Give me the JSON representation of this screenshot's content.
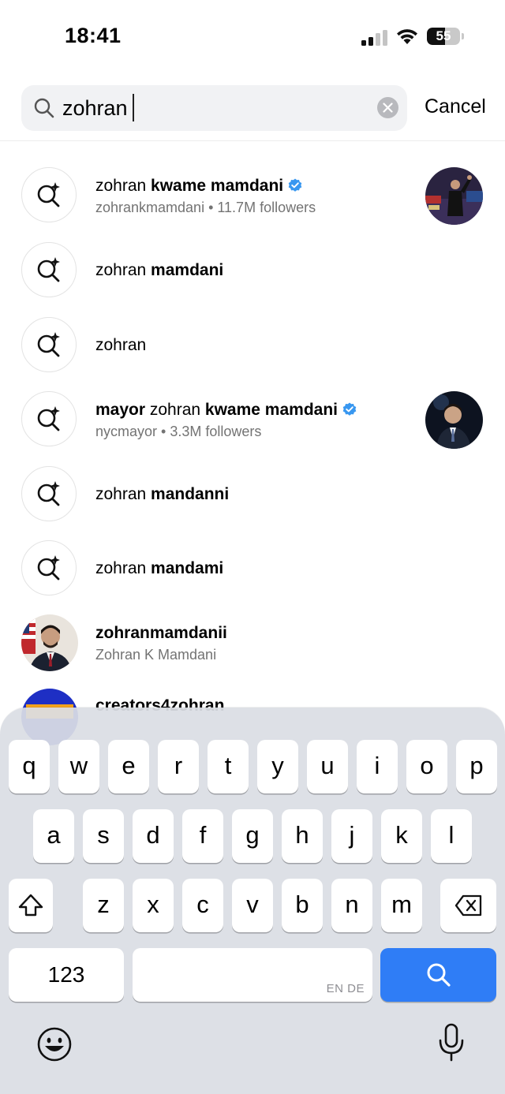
{
  "status_bar": {
    "time": "18:41",
    "battery_level": "55",
    "battery_fraction": 0.55
  },
  "search": {
    "query": "zohran",
    "cancel_label": "Cancel"
  },
  "results": [
    {
      "type": "account",
      "title_plain": "zohran ",
      "title_bold": "kwame mamdani",
      "verified": true,
      "subtitle": "zohrankmamdani • 11.7M followers"
    },
    {
      "type": "query",
      "title_plain": "zohran ",
      "title_bold": "mamdani"
    },
    {
      "type": "query",
      "title_plain": "zohran",
      "title_bold": ""
    },
    {
      "type": "account",
      "title_bold_prefix": "mayor",
      "title_plain": " zohran ",
      "title_bold": "kwame mamdani",
      "verified": true,
      "subtitle": "nycmayor • 3.3M followers"
    },
    {
      "type": "query",
      "title_plain": "zohran ",
      "title_bold": "mandanni"
    },
    {
      "type": "query",
      "title_plain": "zohran ",
      "title_bold": "mandami"
    },
    {
      "type": "account",
      "title_bold": "zohranmamdanii",
      "subtitle": "Zohran K Mamdani"
    },
    {
      "type": "account",
      "title_bold": "creators4zohran"
    }
  ],
  "keyboard": {
    "row1": [
      "q",
      "w",
      "e",
      "r",
      "t",
      "y",
      "u",
      "i",
      "o",
      "p"
    ],
    "row2": [
      "a",
      "s",
      "d",
      "f",
      "g",
      "h",
      "j",
      "k",
      "l"
    ],
    "row3": [
      "z",
      "x",
      "c",
      "v",
      "b",
      "n",
      "m"
    ],
    "numbers_label": "123",
    "space_languages": "EN DE",
    "icons": [
      "shift-icon",
      "delete-icon",
      "search-icon",
      "emoji-icon",
      "microphone-icon"
    ],
    "accent_color": "#2f7df6"
  },
  "colors": {
    "verified_blue": "#3897f0",
    "secondary_text": "#737373"
  }
}
